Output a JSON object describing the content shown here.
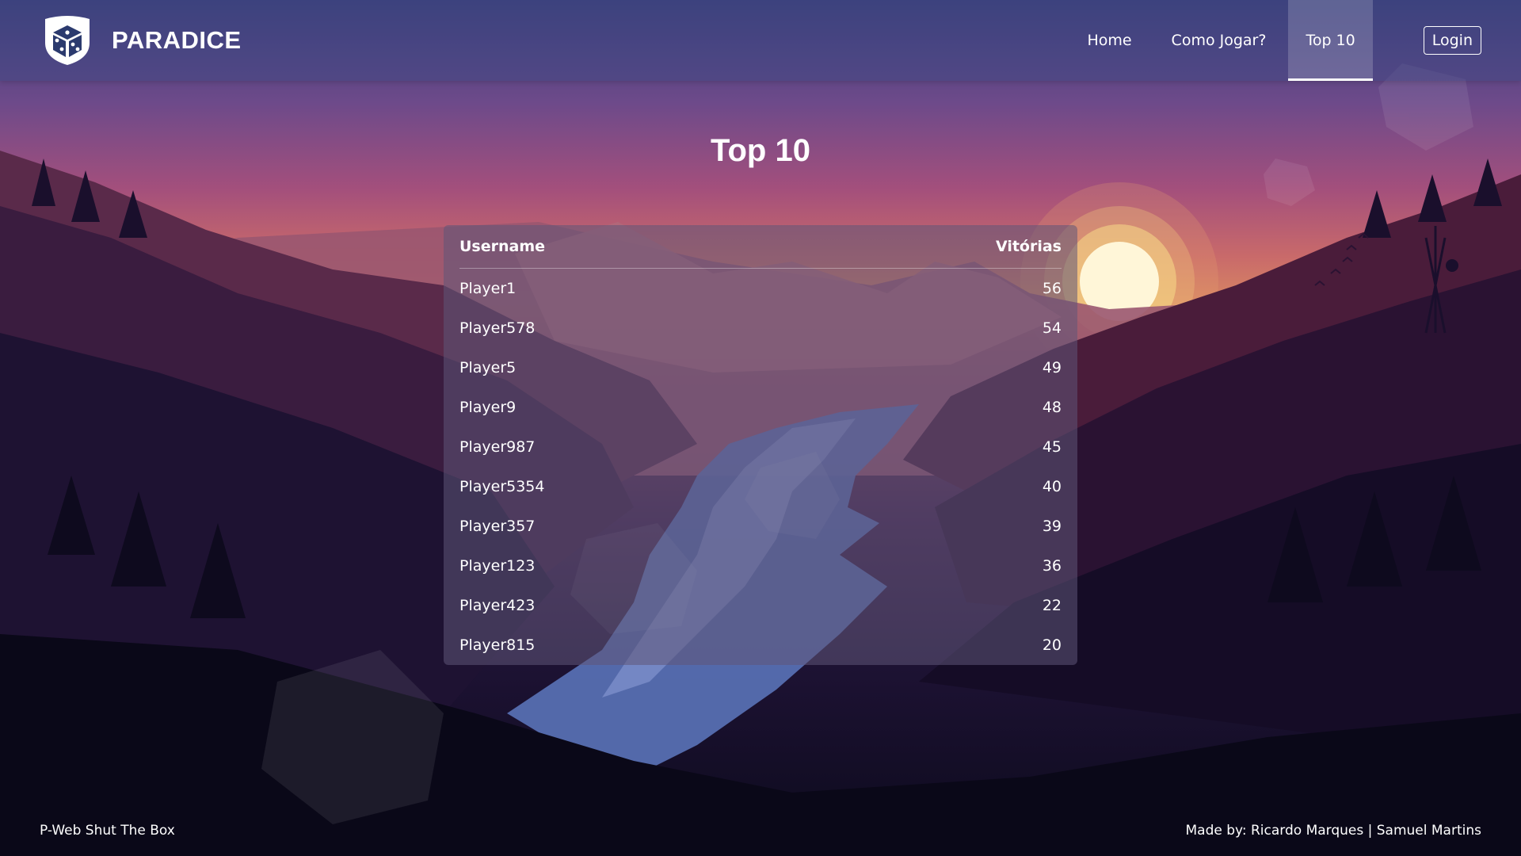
{
  "brand": {
    "name": "PARADICE"
  },
  "nav": {
    "items": [
      {
        "label": "Home"
      },
      {
        "label": "Como Jogar?"
      },
      {
        "label": "Top 10"
      }
    ],
    "login_label": "Login"
  },
  "page": {
    "title": "Top 10"
  },
  "leaderboard": {
    "columns": [
      "Username",
      "Vitórias"
    ],
    "rows": [
      {
        "username": "Player1",
        "wins": "56"
      },
      {
        "username": "Player578",
        "wins": "54"
      },
      {
        "username": "Player5",
        "wins": "49"
      },
      {
        "username": "Player9",
        "wins": "48"
      },
      {
        "username": "Player987",
        "wins": "45"
      },
      {
        "username": "Player5354",
        "wins": "40"
      },
      {
        "username": "Player357",
        "wins": "39"
      },
      {
        "username": "Player123",
        "wins": "36"
      },
      {
        "username": "Player423",
        "wins": "22"
      },
      {
        "username": "Player815",
        "wins": "20"
      }
    ]
  },
  "footer": {
    "left": "P-Web Shut The Box",
    "right": "Made by: Ricardo Marques | Samuel Martins"
  },
  "colors": {
    "sky_top": "#3d3f7a",
    "sky_mid": "#c96a6a",
    "sun": "#fff6d8",
    "forest_dark": "#0c0a1c",
    "river": "#5a73b8"
  },
  "icons": {
    "brand_logo": "dice-shield-icon"
  }
}
